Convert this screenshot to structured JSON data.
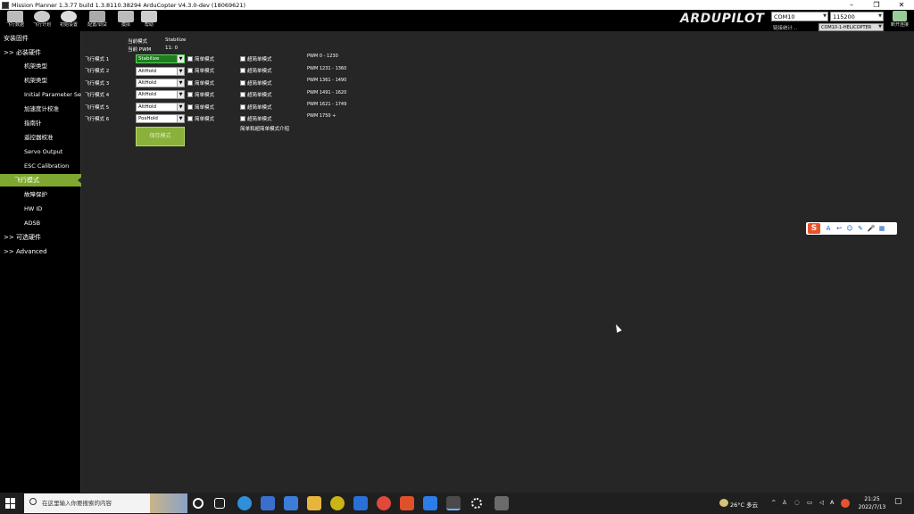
{
  "window": {
    "title": "Mission Planner 1.3.77 build 1.3.8110.38294 ArduCopter V4.3.0-dev (18069621)",
    "minimize": "–",
    "maximize": "❐",
    "close": "✕"
  },
  "toolbar": {
    "items": [
      {
        "label": "飞行数据",
        "color": "#c8c8c8"
      },
      {
        "label": "飞行计划",
        "color": "#c8c8c8"
      },
      {
        "label": "初始设置",
        "color": "#c8c8c8"
      },
      {
        "label": "配置/调试",
        "color": "#c8c8c8"
      },
      {
        "label": "模拟",
        "color": "#c8c8c8"
      },
      {
        "label": "帮助",
        "color": "#c8c8c8"
      }
    ],
    "logo_ardu": "ARDU",
    "logo_pilot": "PILOT",
    "port": "COM10",
    "baud": "115200",
    "status_text": "链接统计...",
    "device": "COM10-1-HELICOPTER",
    "connect_label": "断开连接"
  },
  "sidebar": {
    "title": "安装固件",
    "items": [
      {
        "label": ">> 必装硬件",
        "kind": "header"
      },
      {
        "label": "机架类型",
        "kind": "sub"
      },
      {
        "label": "机架类型",
        "kind": "sub"
      },
      {
        "label": "Initial Parameter Setup",
        "kind": "sub"
      },
      {
        "label": "加速度计校准",
        "kind": "sub"
      },
      {
        "label": "指南针",
        "kind": "sub"
      },
      {
        "label": "遥控器校准",
        "kind": "sub"
      },
      {
        "label": "Servo Output",
        "kind": "sub"
      },
      {
        "label": "ESC Calibration",
        "kind": "sub"
      },
      {
        "label": "飞行模式",
        "kind": "active"
      },
      {
        "label": "故障保护",
        "kind": "sub"
      },
      {
        "label": "HW ID",
        "kind": "sub"
      },
      {
        "label": "ADSB",
        "kind": "sub"
      },
      {
        "label": ">> 可选硬件",
        "kind": "header"
      },
      {
        "label": ">> Advanced",
        "kind": "header"
      }
    ]
  },
  "flight_modes": {
    "current_mode_label": "当前模式",
    "current_mode_value": "Stabilize",
    "current_pwm_label": "当前 PWM",
    "current_pwm_value": "11: 0",
    "modes": [
      {
        "label": "飞行模式 1",
        "value": "Stabilize",
        "simple": "简单模式",
        "super_simple": "超简单模式",
        "pwm": "PWM 0 - 1230",
        "current": true
      },
      {
        "label": "飞行模式 2",
        "value": "AltHold",
        "simple": "简单模式",
        "super_simple": "超简单模式",
        "pwm": "PWM 1231 - 1360",
        "current": false
      },
      {
        "label": "飞行模式 3",
        "value": "AltHold",
        "simple": "简单模式",
        "super_simple": "超简单模式",
        "pwm": "PWM 1361 - 1490",
        "current": false
      },
      {
        "label": "飞行模式 4",
        "value": "AltHold",
        "simple": "简单模式",
        "super_simple": "超简单模式",
        "pwm": "PWM 1491 - 1620",
        "current": false
      },
      {
        "label": "飞行模式 5",
        "value": "AltHold",
        "simple": "简单模式",
        "super_simple": "超简单模式",
        "pwm": "PWM 1621 - 1749",
        "current": false
      },
      {
        "label": "飞行模式 6",
        "value": "PosHold",
        "simple": "简单模式",
        "super_simple": "超简单模式",
        "pwm": "PWM 1750 +",
        "current": false
      }
    ],
    "note": "简单和超简单模式介绍",
    "save_label": "保存模式"
  },
  "ime": {
    "logo": "S",
    "icons": [
      "A",
      "↩",
      "☺",
      "✎",
      "🎤",
      "▦"
    ]
  },
  "taskbar": {
    "search_placeholder": "在这里输入你要搜索的内容",
    "weather": "26°C 多云",
    "time": "21:25",
    "date": "2022/7/13",
    "apps": [
      {
        "name": "cortana",
        "color": "#1f1f1f"
      },
      {
        "name": "task-view",
        "color": "#1f1f1f"
      },
      {
        "name": "edge",
        "color": "#2f8fd8"
      },
      {
        "name": "store",
        "color": "#3a6fd0"
      },
      {
        "name": "mail",
        "color": "#3b7dd8"
      },
      {
        "name": "explorer",
        "color": "#e8b53c"
      },
      {
        "name": "app-yellow",
        "color": "#c9b516"
      },
      {
        "name": "app-blue",
        "color": "#2a6fd6"
      },
      {
        "name": "chrome",
        "color": "#e04a3a"
      },
      {
        "name": "office",
        "color": "#e0502a"
      },
      {
        "name": "app-phone",
        "color": "#2b7de9"
      },
      {
        "name": "mission-planner",
        "color": "#4a4a4a"
      },
      {
        "name": "settings",
        "color": "#1f1f1f"
      },
      {
        "name": "app-grey",
        "color": "#6b6b6b"
      }
    ]
  }
}
